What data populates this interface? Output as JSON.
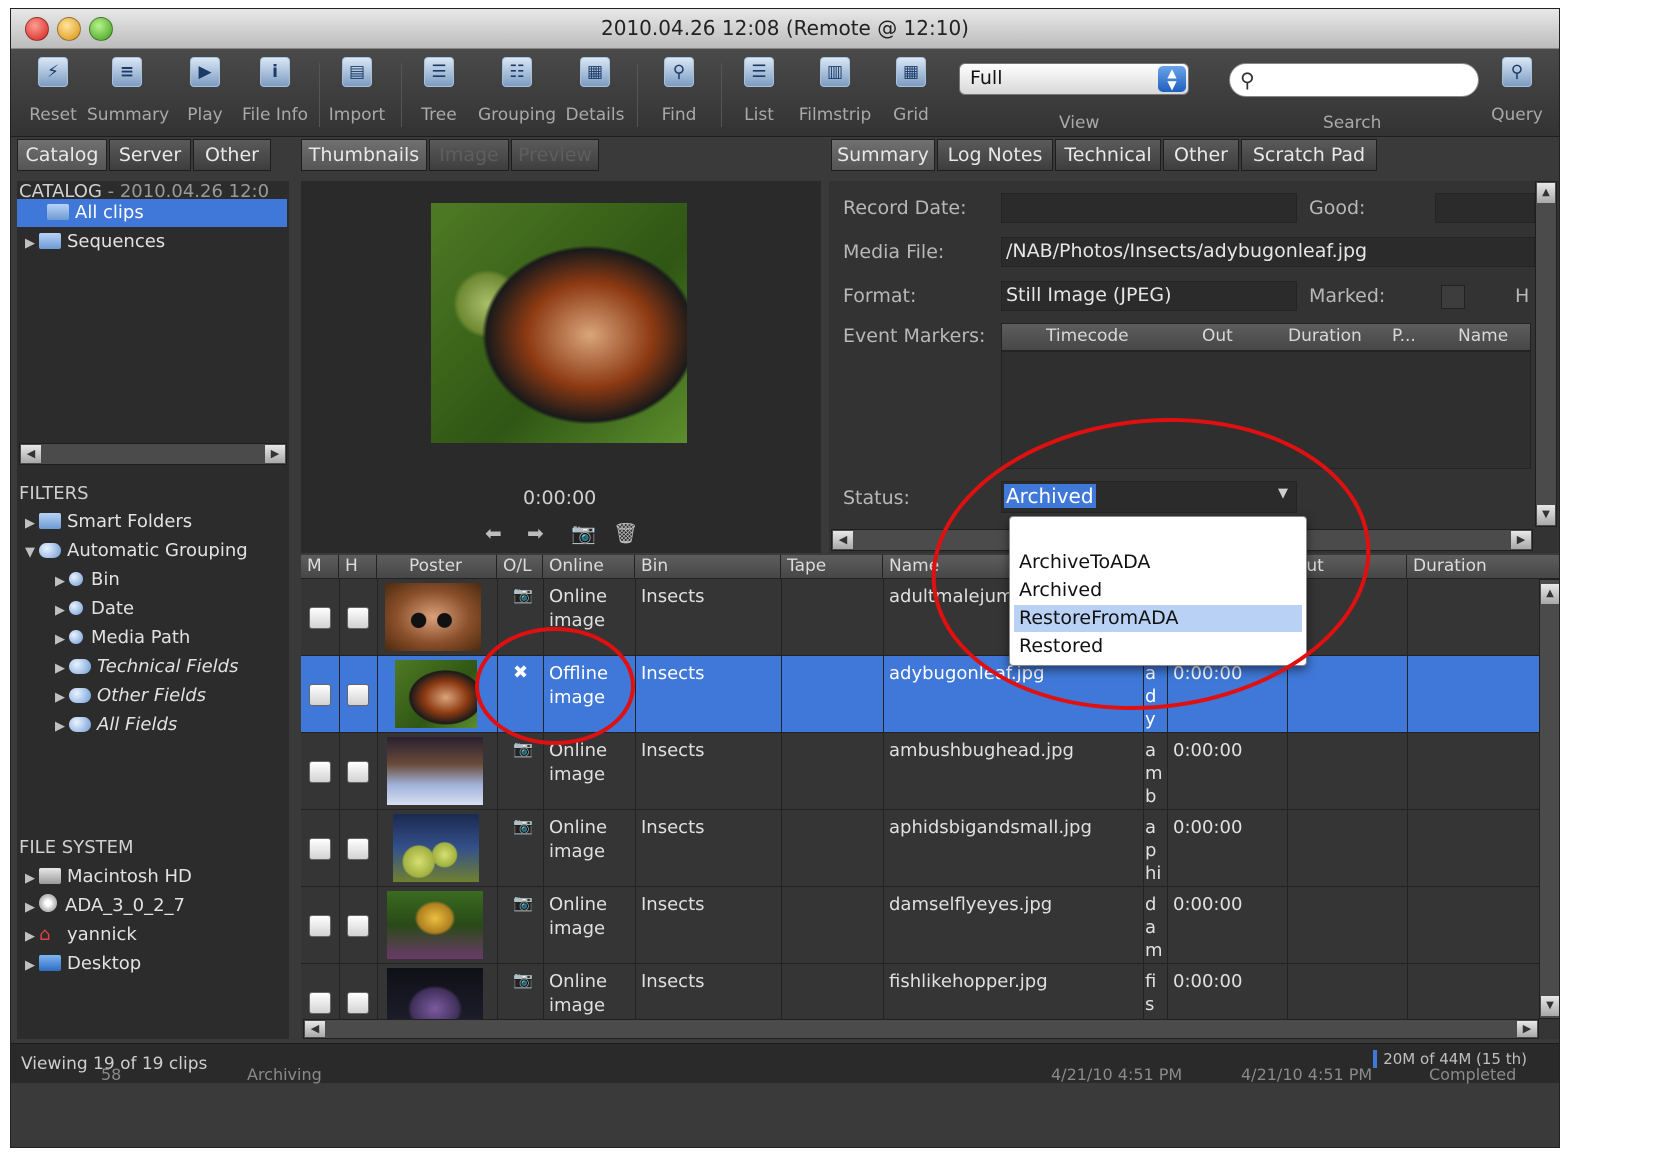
{
  "window": {
    "title": "2010.04.26 12:08 (Remote @ 12:10)"
  },
  "toolbar": {
    "buttons": [
      {
        "label": "Reset",
        "icon": "reset-icon",
        "glyph": "⚡"
      },
      {
        "label": "Summary",
        "icon": "summary-icon",
        "glyph": "≡"
      },
      {
        "label": "Play",
        "icon": "play-icon",
        "glyph": "▶"
      },
      {
        "label": "File Info",
        "icon": "info-icon",
        "glyph": "i"
      },
      {
        "label": "Import",
        "icon": "import-icon",
        "glyph": "▤"
      },
      {
        "label": "Tree",
        "icon": "tree-icon",
        "glyph": "☰"
      },
      {
        "label": "Grouping",
        "icon": "grouping-icon",
        "glyph": "☷"
      },
      {
        "label": "Details",
        "icon": "details-icon",
        "glyph": "▦"
      },
      {
        "label": "Find",
        "icon": "find-icon",
        "glyph": "⚲"
      },
      {
        "label": "List",
        "icon": "list-icon",
        "glyph": "☰"
      },
      {
        "label": "Filmstrip",
        "icon": "filmstrip-icon",
        "glyph": "▥"
      },
      {
        "label": "Grid",
        "icon": "grid-icon",
        "glyph": "▦"
      },
      {
        "label": "Query",
        "icon": "query-icon",
        "glyph": "⚲"
      }
    ],
    "view_value": "Full",
    "view_label": "View",
    "search_label": "Search",
    "search_value": ""
  },
  "left_tabs": [
    "Catalog",
    "Server",
    "Other"
  ],
  "catalog": {
    "header": "CATALOG",
    "header_date": "- 2010.04.26 12:0",
    "items": [
      "All clips",
      "Sequences"
    ]
  },
  "filters": {
    "header": "FILTERS",
    "items": [
      "Smart Folders",
      "Automatic Grouping",
      "Bin",
      "Date",
      "Media Path",
      "Technical Fields",
      "Other Fields",
      "All Fields"
    ]
  },
  "filesystem": {
    "header": "FILE SYSTEM",
    "items": [
      "Macintosh HD",
      "ADA_3_0_2_7",
      "yannick",
      "Desktop"
    ]
  },
  "preview_tabs": [
    "Thumbnails",
    "Image",
    "Preview"
  ],
  "preview": {
    "timecode": "0:00:00"
  },
  "summary_tabs": [
    "Summary",
    "Log Notes",
    "Technical",
    "Other",
    "Scratch Pad"
  ],
  "summary": {
    "record_date_label": "Record Date:",
    "record_date": "",
    "good_label": "Good:",
    "media_file_label": "Media File:",
    "media_file": "/NAB/Photos/Insects/adybugonleaf.jpg",
    "format_label": "Format:",
    "format": "Still Image (JPEG)",
    "marked_label": "Marked:",
    "h_label": "H",
    "event_markers_label": "Event Markers:",
    "event_columns": [
      "Timecode",
      "Out",
      "Duration",
      "P...",
      "Name"
    ],
    "status_label": "Status:",
    "status_value": "Archived"
  },
  "status_dropdown": {
    "options": [
      "ArchiveToADA",
      "Archived",
      "RestoreFromADA",
      "Restored"
    ],
    "highlighted": "RestoreFromADA"
  },
  "table": {
    "columns": [
      "M",
      "H",
      "Poster",
      "O/L",
      "Online",
      "Bin",
      "Tape",
      "Name",
      "",
      "Out",
      "Duration"
    ],
    "rows": [
      {
        "online": [
          "Online",
          "image"
        ],
        "bin": "Insects",
        "name": "adultmalejum",
        "abbr": [],
        "tc": ""
      },
      {
        "online": [
          "Offline",
          "image"
        ],
        "bin": "Insects",
        "name": "adybugonleaf.jpg",
        "abbr": [
          "a",
          "d",
          "y"
        ],
        "tc": "0:00:00"
      },
      {
        "online": [
          "Online",
          "image"
        ],
        "bin": "Insects",
        "name": "ambushbughead.jpg",
        "abbr": [
          "a",
          "m",
          "b"
        ],
        "tc": "0:00:00"
      },
      {
        "online": [
          "Online",
          "image"
        ],
        "bin": "Insects",
        "name": "aphidsbigandsmall.jpg",
        "abbr": [
          "a",
          "p",
          "hi"
        ],
        "tc": "0:00:00"
      },
      {
        "online": [
          "Online",
          "image"
        ],
        "bin": "Insects",
        "name": "damselflyeyes.jpg",
        "abbr": [
          "d",
          "a",
          "m"
        ],
        "tc": "0:00:00"
      },
      {
        "online": [
          "Online",
          "image"
        ],
        "bin": "Insects",
        "name": "fishlikehopper.jpg",
        "abbr": [
          "fi",
          "s"
        ],
        "tc": "0:00:00"
      }
    ]
  },
  "statusbar": {
    "left": "Viewing 19 of 19 clips",
    "right": "20M of 44M (15 th)",
    "underlay": [
      "58",
      "Archiving",
      "4/21/10 4:51 PM",
      "4/21/10 4:51 PM",
      "Completed"
    ]
  },
  "colors": {
    "selection": "#3f78d8",
    "annotation": "#e01010"
  }
}
